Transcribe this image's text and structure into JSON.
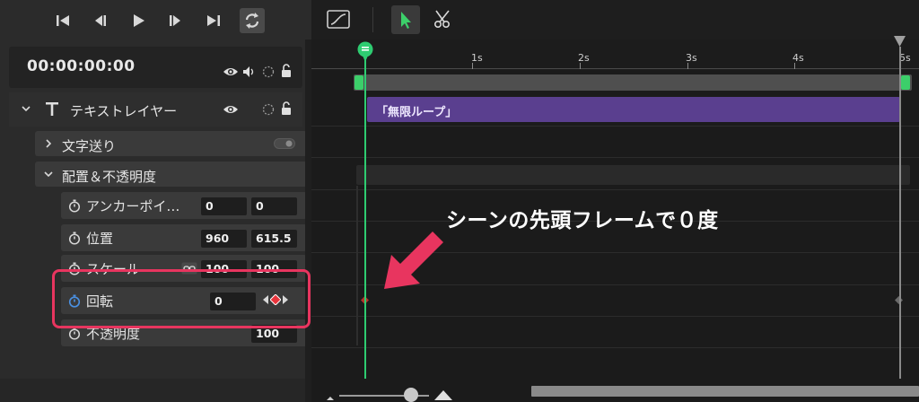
{
  "transport": {
    "buttons": [
      "skip-to-start",
      "step-back",
      "play",
      "step-forward",
      "skip-to-end",
      "loop"
    ]
  },
  "timecode": "00:00:00:00",
  "layer": {
    "name": "テキストレイヤー"
  },
  "groups": {
    "text_advance": "文字送り",
    "transform": "配置＆不透明度"
  },
  "properties": {
    "anchor": {
      "label": "アンカーポイ…",
      "x": "0",
      "y": "0"
    },
    "position": {
      "label": "位置",
      "x": "960",
      "y": "615.5"
    },
    "scale": {
      "label": "スケール",
      "x": "100",
      "y": "100"
    },
    "rotation": {
      "label": "回転",
      "value": "0"
    },
    "opacity": {
      "label": "不透明度",
      "value": "100"
    }
  },
  "ruler": {
    "ticks": [
      "1s",
      "2s",
      "3s",
      "4s",
      "5s"
    ]
  },
  "clip": {
    "label": "「無限ループ」"
  },
  "annotation": "シーンの先頭フレームで０度",
  "colors": {
    "playhead": "#2ecc71",
    "clip": "#5a3f8f",
    "highlight": "#e8355f",
    "keyframe": "#e8343c",
    "timer_active": "#4a90e2"
  }
}
